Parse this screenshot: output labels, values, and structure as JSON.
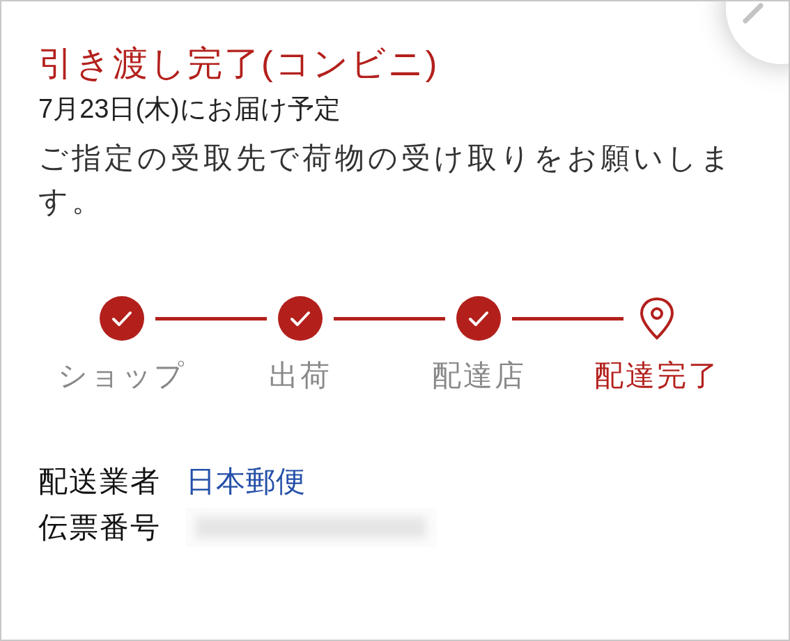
{
  "status_title": "引き渡し完了(コンビニ)",
  "delivery_date": "7月23日(木)にお届け予定",
  "message": "ご指定の受取先で荷物の受け取りをお願いします。",
  "steps": [
    {
      "label": "ショップ",
      "kind": "done"
    },
    {
      "label": "出荷",
      "kind": "done"
    },
    {
      "label": "配達店",
      "kind": "done"
    },
    {
      "label": "配達完了",
      "kind": "current"
    }
  ],
  "details": [
    {
      "label": "配送業者",
      "kind": "link",
      "value": "日本郵便"
    },
    {
      "label": "伝票番号",
      "kind": "redacted"
    }
  ]
}
